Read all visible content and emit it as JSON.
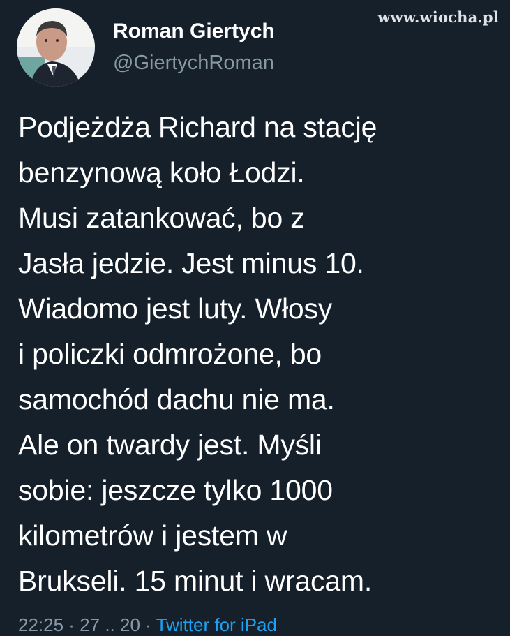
{
  "watermark": "www.wiocha.pl",
  "author": {
    "name": "Roman Giertych",
    "handle": "@GiertychRoman",
    "avatar_icon": "profile-photo-avatar"
  },
  "tweet": {
    "text": "Podjeżdża Richard na stację\nbenzynową koło Łodzi.\nMusi zatankować, bo z\nJasła jedzie. Jest minus 10.\nWiadomo jest luty. Włosy\ni policzki odmrożone, bo\nsamochód dachu nie ma.\nAle on twardy jest. Myśli\nsobie: jeszcze tylko 1000\nkilometrów i jestem w\nBrukseli. 15 minut i wracam."
  },
  "footer": {
    "timestamp": "22:25 · 27 .. 20 ·",
    "source": "Twitter for iPad"
  },
  "colors": {
    "background": "#15202b",
    "text": "#ffffff",
    "muted": "#8899a6",
    "link": "#1da1f2"
  }
}
